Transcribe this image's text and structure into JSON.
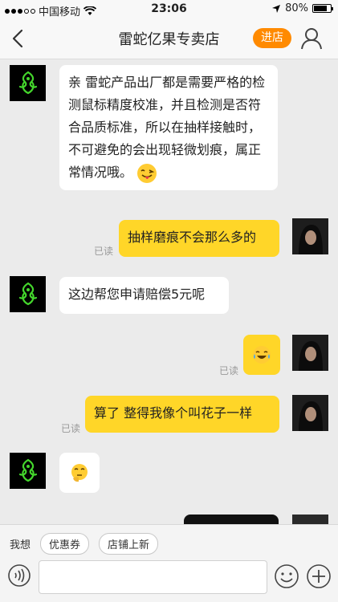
{
  "status_bar": {
    "carrier": "中国移动",
    "time": "23:06",
    "battery": "80%",
    "battery_level": 0.8
  },
  "nav": {
    "title": "雷蛇亿果专卖店",
    "store_button": "进店"
  },
  "messages": [
    {
      "from": "shop",
      "text": "亲 雷蛇产品出厂都是需要严格的检测鼠标精度校准，并且检测是否符合品质标准，所以在抽样接触时，  不可避免的会出现轻微划痕，属正常情况哦。",
      "emoji": "tongue-wink-icon"
    },
    {
      "from": "me",
      "text": "抽样磨痕不会那么多的",
      "read": "已读"
    },
    {
      "from": "shop",
      "text": "这边帮您申请赔偿5元呢"
    },
    {
      "from": "me",
      "text": "",
      "emoji": "tears-of-joy-icon",
      "read": "已读"
    },
    {
      "from": "me",
      "text": "算了 整得我像个叫花子一样",
      "read": "已读"
    },
    {
      "from": "shop",
      "text": "",
      "emoji": "thinking-face-icon"
    }
  ],
  "bottom": {
    "label": "我想",
    "chips": [
      "优惠券",
      "店铺上新"
    ],
    "input_value": ""
  },
  "colors": {
    "accent": "#ff8a00",
    "out_bubble": "#ffd628",
    "in_bubble": "#ffffff",
    "razer_green": "#44d62c"
  }
}
